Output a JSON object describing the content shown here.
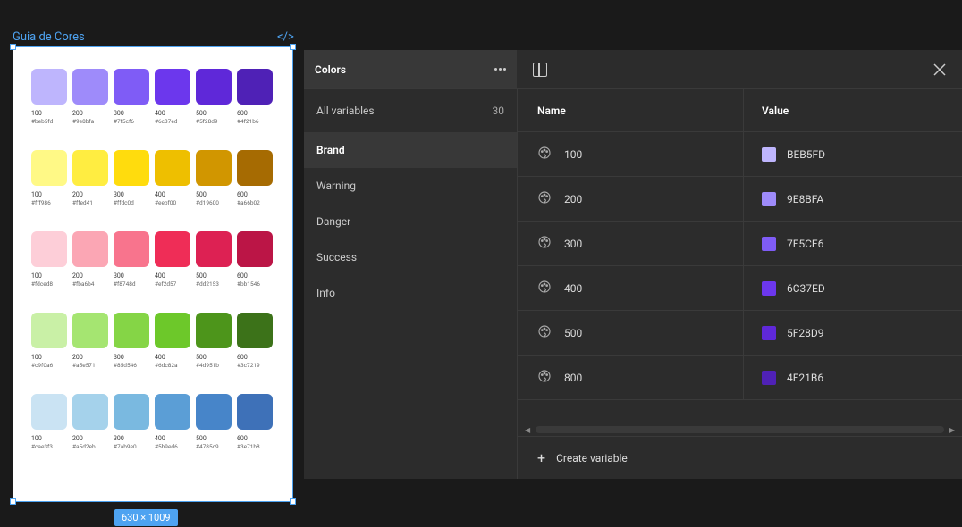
{
  "frame": {
    "label": "Guia de Cores",
    "dimensions": "630 × 1009"
  },
  "palette_rows": [
    [
      {
        "shade": "100",
        "hex": "#beb5fd",
        "color": "#beb5fd"
      },
      {
        "shade": "200",
        "hex": "#9e8bfa",
        "color": "#9e8bfa"
      },
      {
        "shade": "300",
        "hex": "#7f5cf6",
        "color": "#7f5cf6"
      },
      {
        "shade": "400",
        "hex": "#6c37ed",
        "color": "#6c37ed"
      },
      {
        "shade": "500",
        "hex": "#5f28d9",
        "color": "#5f28d9"
      },
      {
        "shade": "600",
        "hex": "#4f21b6",
        "color": "#4f21b6"
      }
    ],
    [
      {
        "shade": "100",
        "hex": "#fff986",
        "color": "#fff986"
      },
      {
        "shade": "200",
        "hex": "#ffed41",
        "color": "#ffed41"
      },
      {
        "shade": "300",
        "hex": "#ffdc0d",
        "color": "#ffdc0d"
      },
      {
        "shade": "400",
        "hex": "#eebf00",
        "color": "#eebf00"
      },
      {
        "shade": "500",
        "hex": "#d19600",
        "color": "#d19600"
      },
      {
        "shade": "600",
        "hex": "#a66b02",
        "color": "#a66b02"
      }
    ],
    [
      {
        "shade": "100",
        "hex": "#fdced8",
        "color": "#fdced8"
      },
      {
        "shade": "200",
        "hex": "#fba6b4",
        "color": "#fba6b4"
      },
      {
        "shade": "300",
        "hex": "#f8748d",
        "color": "#f8748d"
      },
      {
        "shade": "400",
        "hex": "#ef2d57",
        "color": "#ef2d57"
      },
      {
        "shade": "500",
        "hex": "#dd2153",
        "color": "#dd2153"
      },
      {
        "shade": "600",
        "hex": "#bb1546",
        "color": "#bb1546"
      }
    ],
    [
      {
        "shade": "100",
        "hex": "#c9f0a6",
        "color": "#c9f0a6"
      },
      {
        "shade": "200",
        "hex": "#a5e571",
        "color": "#a5e571"
      },
      {
        "shade": "300",
        "hex": "#85d546",
        "color": "#85d546"
      },
      {
        "shade": "400",
        "hex": "#6dc82a",
        "color": "#6dc82a"
      },
      {
        "shade": "500",
        "hex": "#4d951b",
        "color": "#4d951b"
      },
      {
        "shade": "600",
        "hex": "#3c7219",
        "color": "#3c7219"
      }
    ],
    [
      {
        "shade": "100",
        "hex": "#cae3f3",
        "color": "#cae3f3"
      },
      {
        "shade": "200",
        "hex": "#a5d2eb",
        "color": "#a5d2eb"
      },
      {
        "shade": "300",
        "hex": "#7ab9e0",
        "color": "#7ab9e0"
      },
      {
        "shade": "400",
        "hex": "#5b9ed6",
        "color": "#5b9ed6"
      },
      {
        "shade": "500",
        "hex": "#4785c9",
        "color": "#4785c9"
      },
      {
        "shade": "600",
        "hex": "#3e71b8",
        "color": "#3e71b8"
      }
    ]
  ],
  "panel": {
    "title": "Colors",
    "all_label": "All variables",
    "all_count": "30",
    "groups": [
      "Brand",
      "Warning",
      "Danger",
      "Success",
      "Info"
    ],
    "selected_group": "Brand",
    "headers": {
      "name": "Name",
      "value": "Value"
    },
    "variables": [
      {
        "name": "100",
        "hex": "BEB5FD",
        "color": "#beb5fd"
      },
      {
        "name": "200",
        "hex": "9E8BFA",
        "color": "#9e8bfa"
      },
      {
        "name": "300",
        "hex": "7F5CF6",
        "color": "#7f5cf6"
      },
      {
        "name": "400",
        "hex": "6C37ED",
        "color": "#6c37ed"
      },
      {
        "name": "500",
        "hex": "5F28D9",
        "color": "#5f28d9"
      },
      {
        "name": "800",
        "hex": "4F21B6",
        "color": "#4f21b6"
      }
    ],
    "create_label": "Create variable"
  }
}
